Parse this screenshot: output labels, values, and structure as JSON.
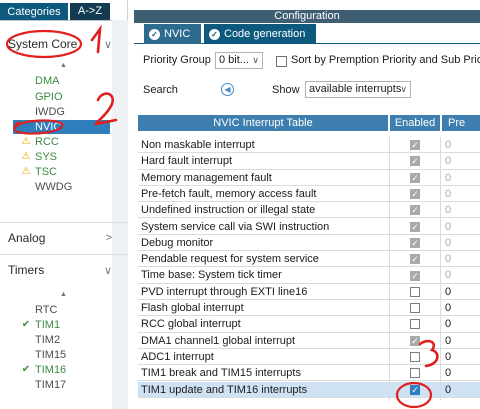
{
  "left_panel": {
    "tabs": [
      {
        "label": "Categories"
      },
      {
        "label": "A->Z"
      }
    ],
    "system_core": {
      "label": "System Core",
      "items": [
        {
          "label": "DMA",
          "status": "ok"
        },
        {
          "label": "GPIO",
          "status": "ok"
        },
        {
          "label": "IWDG",
          "status": "none"
        },
        {
          "label": "NVIC",
          "status": "selected"
        },
        {
          "label": "RCC",
          "status": "warning"
        },
        {
          "label": "SYS",
          "status": "warning"
        },
        {
          "label": "TSC",
          "status": "warning"
        },
        {
          "label": "WWDG",
          "status": "none"
        }
      ]
    },
    "analog": {
      "label": "Analog"
    },
    "timers": {
      "label": "Timers",
      "items": [
        {
          "label": "RTC",
          "status": "none"
        },
        {
          "label": "TIM1",
          "status": "enabled"
        },
        {
          "label": "TIM2",
          "status": "none"
        },
        {
          "label": "TIM15",
          "status": "none"
        },
        {
          "label": "TIM16",
          "status": "enabled"
        },
        {
          "label": "TIM17",
          "status": "none"
        }
      ]
    }
  },
  "config": {
    "title": "Configuration",
    "tabs": [
      {
        "label": "NVIC"
      },
      {
        "label": "Code generation"
      }
    ],
    "priority_group_label": "Priority Group",
    "priority_group_value": "0 bit...",
    "sort_label": "Sort by Premption Priority and Sub Priorit",
    "search_label": "Search",
    "show_label": "Show",
    "show_value": "available interrupts"
  },
  "table": {
    "headers": {
      "name": "NVIC Interrupt Table",
      "enabled": "Enabled",
      "preemption": "Pre"
    },
    "rows": [
      {
        "name": "Non maskable interrupt",
        "enabled": true,
        "locked": true,
        "priority": "0"
      },
      {
        "name": "Hard fault interrupt",
        "enabled": true,
        "locked": true,
        "priority": "0"
      },
      {
        "name": "Memory management fault",
        "enabled": true,
        "locked": true,
        "priority": "0"
      },
      {
        "name": "Pre-fetch fault, memory access fault",
        "enabled": true,
        "locked": true,
        "priority": "0"
      },
      {
        "name": "Undefined instruction or illegal state",
        "enabled": true,
        "locked": true,
        "priority": "0"
      },
      {
        "name": "System service call via SWI instruction",
        "enabled": true,
        "locked": true,
        "priority": "0"
      },
      {
        "name": "Debug monitor",
        "enabled": true,
        "locked": true,
        "priority": "0"
      },
      {
        "name": "Pendable request for system service",
        "enabled": true,
        "locked": true,
        "priority": "0"
      },
      {
        "name": "Time base: System tick timer",
        "enabled": true,
        "locked": true,
        "priority": "0"
      },
      {
        "name": "PVD interrupt through EXTI line16",
        "enabled": false,
        "locked": false,
        "priority": "0"
      },
      {
        "name": "Flash global interrupt",
        "enabled": false,
        "locked": false,
        "priority": "0"
      },
      {
        "name": "RCC global interrupt",
        "enabled": false,
        "locked": false,
        "priority": "0"
      },
      {
        "name": "DMA1 channel1 global interrupt",
        "enabled": true,
        "locked": true,
        "priority": "0"
      },
      {
        "name": "ADC1 interrupt",
        "enabled": false,
        "locked": false,
        "priority": "0"
      },
      {
        "name": "TIM1 break and TIM15 interrupts",
        "enabled": false,
        "locked": false,
        "priority": "0"
      },
      {
        "name": "TIM1 update and TIM16 interrupts",
        "enabled": true,
        "locked": false,
        "priority": "0",
        "highlighted": true
      }
    ]
  },
  "annotations": [
    "1",
    "2",
    "3"
  ],
  "colors": {
    "accent": "#0e5a7f",
    "selected": "#2f7fbf",
    "annotation": "#e0201e",
    "warning": "#e5a700",
    "ok": "#3c8c3f"
  }
}
